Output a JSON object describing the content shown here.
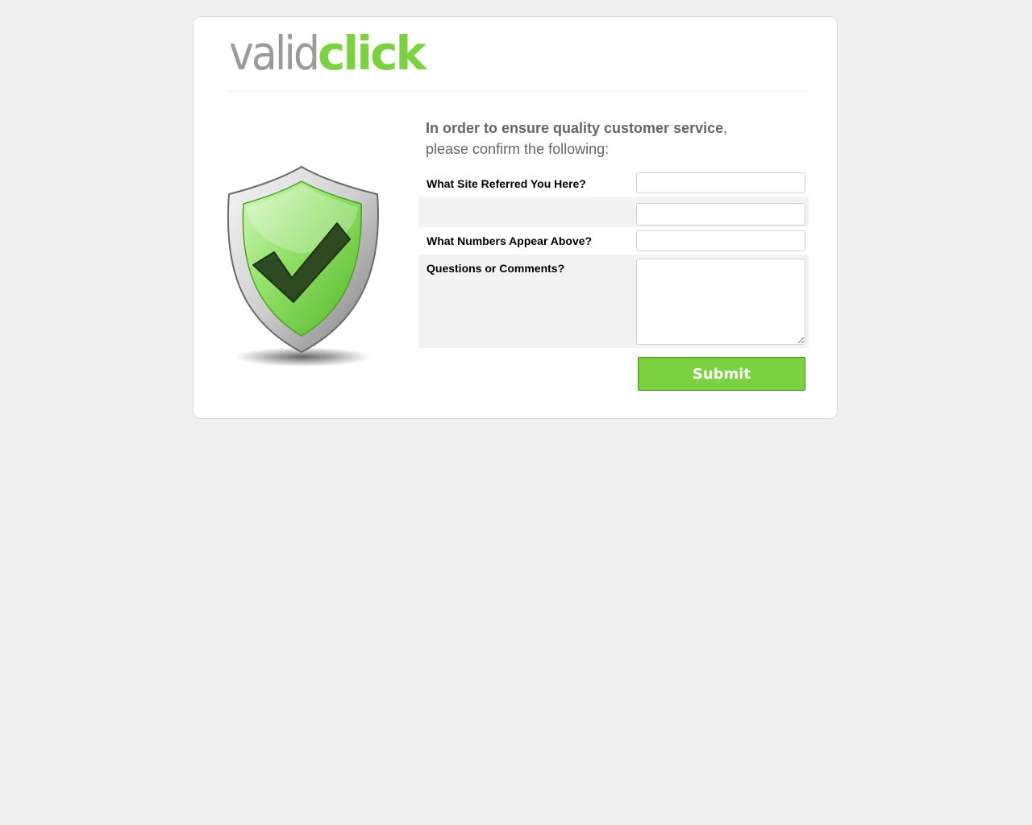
{
  "logo": {
    "part1": "valid",
    "part2": "click",
    "accent_color": "#7bd142",
    "gray_color": "#9a9a9a"
  },
  "shield": {
    "icon": "shield-check-icon",
    "color": "#7bd142"
  },
  "intro": {
    "line1_bold": "In order to ensure quality customer service",
    "line1_tail": ",",
    "line2": "please confirm the following:"
  },
  "form": {
    "site_label": "What Site Referred You Here?",
    "site_value": "",
    "captcha_value": "",
    "numbers_label": "What Numbers Appear Above?",
    "numbers_value": "",
    "comments_label": "Questions or Comments?",
    "comments_value": ""
  },
  "submit_label": "Submit"
}
